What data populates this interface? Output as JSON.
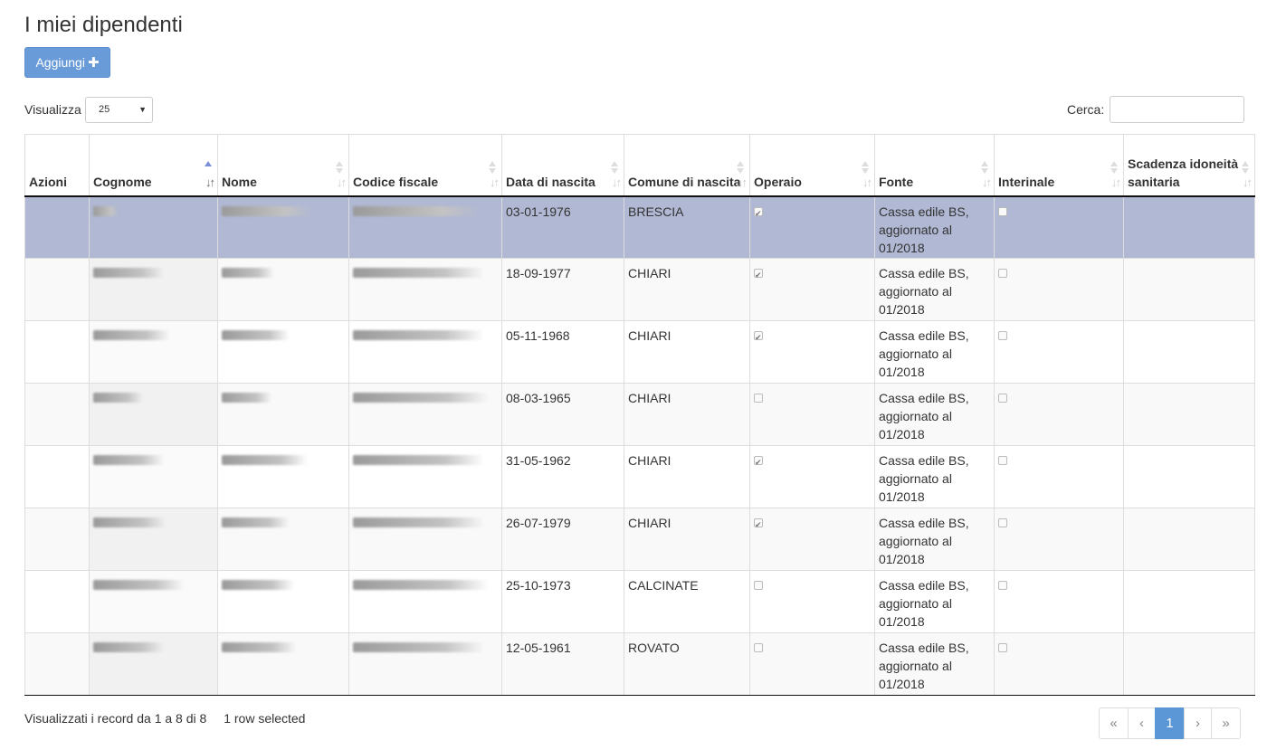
{
  "page": {
    "title": "I miei dipendenti"
  },
  "toolbar": {
    "add_label": "Aggiungi",
    "add_icon": "plus-icon"
  },
  "length": {
    "label": "Visualizza",
    "value": "25"
  },
  "search": {
    "label": "Cerca:",
    "value": ""
  },
  "table": {
    "columns": [
      "Azioni",
      "Cognome",
      "Nome",
      "Codice fiscale",
      "Data di nascita",
      "Comune di nascita",
      "Operaio",
      "Fonte",
      "Interinale",
      "Scadenza idoneità sanitaria"
    ],
    "sorted_column": "Cognome",
    "sort_direction": "asc",
    "rows": [
      {
        "selected": true,
        "data_nascita": "03-01-1976",
        "comune": "BRESCIA",
        "operaio": true,
        "fonte": "Cassa edile BS, aggiornato al 01/2018",
        "interinale": false
      },
      {
        "selected": false,
        "data_nascita": "18-09-1977",
        "comune": "CHIARI",
        "operaio": true,
        "fonte": "Cassa edile BS, aggiornato al 01/2018",
        "interinale": false
      },
      {
        "selected": false,
        "data_nascita": "05-11-1968",
        "comune": "CHIARI",
        "operaio": true,
        "fonte": "Cassa edile BS, aggiornato al 01/2018",
        "interinale": false
      },
      {
        "selected": false,
        "data_nascita": "08-03-1965",
        "comune": "CHIARI",
        "operaio": false,
        "fonte": "Cassa edile BS, aggiornato al 01/2018",
        "interinale": false
      },
      {
        "selected": false,
        "data_nascita": "31-05-1962",
        "comune": "CHIARI",
        "operaio": true,
        "fonte": "Cassa edile BS, aggiornato al 01/2018",
        "interinale": false
      },
      {
        "selected": false,
        "data_nascita": "26-07-1979",
        "comune": "CHIARI",
        "operaio": true,
        "fonte": "Cassa edile BS, aggiornato al 01/2018",
        "interinale": false
      },
      {
        "selected": false,
        "data_nascita": "25-10-1973",
        "comune": "CALCINATE",
        "operaio": false,
        "fonte": "Cassa edile BS, aggiornato al 01/2018",
        "interinale": false
      },
      {
        "selected": false,
        "data_nascita": "12-05-1961",
        "comune": "ROVATO",
        "operaio": false,
        "fonte": "Cassa edile BS, aggiornato al 01/2018",
        "interinale": false
      }
    ]
  },
  "footer": {
    "info": "Visualizzati i record da 1 a 8 di 8",
    "selected": "1 row selected"
  },
  "pagination": {
    "first": "«",
    "prev": "‹",
    "current": "1",
    "next": "›",
    "last": "»"
  },
  "colors": {
    "accent": "#5b96d6",
    "selected_row": "#b0b8d3",
    "add_button": "#6a9bd9"
  }
}
